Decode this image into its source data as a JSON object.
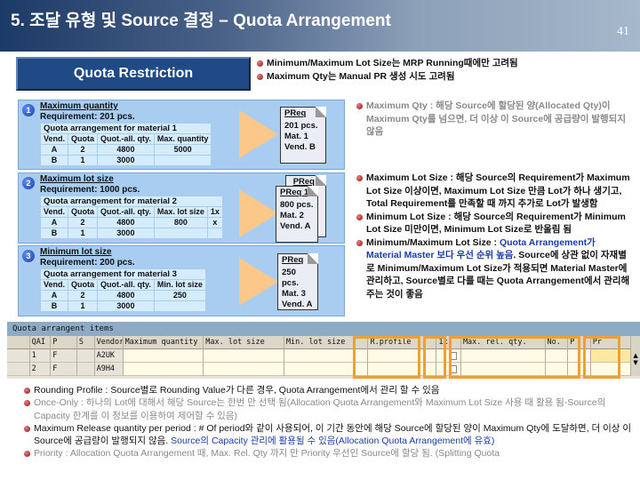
{
  "header": {
    "title": "5. 조달 유형 및 Source 결정 – Quota Arrangement",
    "page_number": "41"
  },
  "quota_restriction": {
    "label": "Quota Restriction"
  },
  "top_bullets": [
    "Minimum/Maximum Lot Size는 MRP Running때에만 고려됨",
    "Maximum Qty는 Manual PR 생성 시도 고려됨"
  ],
  "panels": [
    {
      "number": "1",
      "title": "Maximum quantity",
      "requirement": "Requirement: 201 pcs.",
      "caption": "Quota arrangement for material 1",
      "headers": [
        "Vend.",
        "Quota",
        "Quot.-all. qty.",
        "Max. quantity"
      ],
      "rows": [
        [
          "A",
          "2",
          "4800",
          "5000"
        ],
        [
          "B",
          "1",
          "3000",
          ""
        ]
      ],
      "preq": {
        "title": "PReq",
        "lines": [
          "201 pcs.",
          "Mat. 1",
          "Vend. B"
        ]
      }
    },
    {
      "number": "2",
      "title": "Maximum lot size",
      "requirement": "Requirement: 1000 pcs.",
      "caption": "Quota arrangement for material 2",
      "headers": [
        "Vend.",
        "Quota",
        "Quot.-all. qty.",
        "Max. lot size",
        "1x"
      ],
      "rows": [
        [
          "A",
          "2",
          "4800",
          "800",
          "x"
        ],
        [
          "B",
          "1",
          "3000",
          "",
          ""
        ]
      ],
      "preq_back": {
        "title": "PReq 2"
      },
      "preq": {
        "title": "PReq 1",
        "lines": [
          "800 pcs.",
          "Mat. 2",
          "Vend. A"
        ]
      }
    },
    {
      "number": "3",
      "title": "Minimum lot size",
      "requirement": "Requirement: 200 pcs.",
      "caption": "Quota arrangement for material 3",
      "headers": [
        "Vend.",
        "Quota",
        "Quot.-all. qty.",
        "Min. lot size"
      ],
      "rows": [
        [
          "A",
          "2",
          "4800",
          "250"
        ],
        [
          "B",
          "1",
          "3000",
          ""
        ]
      ],
      "preq": {
        "title": "PReq",
        "lines": [
          "250 pcs.",
          "Mat. 3",
          "Vend. A"
        ]
      }
    }
  ],
  "right_bullets": {
    "max_qty": "Maximum Qty : 해당 Source에 할당된 양(Allocated Qty)이 Maximum  Qty를 넘으면, 더 이상 이 Source에 공급량이 발행되지 않음",
    "max_lot": "Maximum Lot Size : 해당 Source의 Requirement가 Maximum Lot Size 이상이면, Maximum Lot Size 만큼 Lot가 하나 생기고, Total Requirement를 만족할 때 까지 추가로 Lot가 발생함",
    "min_lot": "Minimum Lot Size : 해당 Source의 Requirement가 Minimum Lot Size 미만이면, Minimum Lot Size로 반올림 됨",
    "minmax_prefix": "Minimum/Maximum Lot Size : ",
    "minmax_blue": "Quota Arrangement가 Material Master 보다 우선 순위 높음",
    "minmax_rest": ". Source에 상관 없이 자재별로 Minimum/Maximum Lot Size가 적용되면 Material Master에 관리하고, Source별로 다를 때는 Quota Arrangement에서 관리해주는 것이 좋음"
  },
  "sap_table": {
    "title": "Quota arrangent items",
    "columns": [
      "QAI",
      "P",
      "S",
      "Vendor",
      "Maximum quantity",
      "Max. lot size",
      "Min. lot size",
      "R.profile",
      "1x",
      "Max. rel. qty.",
      "No.",
      "P",
      "Pr"
    ],
    "rows": [
      [
        "1",
        "F",
        "",
        "A2UK",
        "",
        "",
        "",
        "",
        "",
        "",
        "",
        "",
        ""
      ],
      [
        "2",
        "F",
        "",
        "A9H4",
        "",
        "",
        "",
        "",
        "",
        "",
        "",
        "",
        ""
      ]
    ]
  },
  "bottom_bullets": {
    "rounding": "Rounding Profile : Source별로 Rounding Value가 다른 경우, Quota Arrangement에서 관리 할 수 있음",
    "once_only": "Once-Only : 하나의 Lot에 대해서 해당 Source는 한번 만 선택 됨(Allocation Quota Arrangement와 Maximum Lot Size 사용 때 활용 됨-Source의 Capacity 한계를 이 정보를 이용하여 제어할 수 있음)",
    "max_release_black": "Maximum Release quantity per period : # Of period와 같이 사용되어, 이 기간 동안에 해당 Source에 할당된 양이 Maximum Qty에 도달하면, 더 이상 이 Source에 공급량이 발행되지 않음. ",
    "max_release_blue": "Source의 Capacity 관리에 활용될 수 있음(Allocation Quota Arrangement에 유효)",
    "priority": "Priority : Allocation Quota Arrangement 때, Max. Rel. Qty 까지 만 Priority 우선인 Source에 할당 됨. (Splitting Quota"
  }
}
